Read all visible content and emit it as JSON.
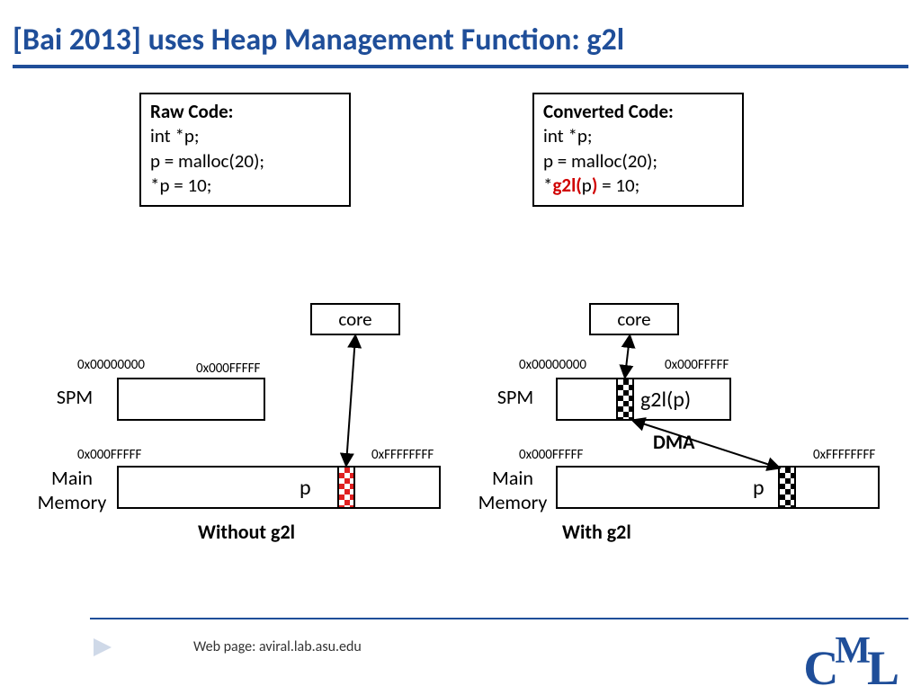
{
  "title": "[Bai 2013] uses Heap Management Function: g2l",
  "rawCode": {
    "header": "Raw Code:",
    "line1": "int *p;",
    "line2": "p = malloc(20);",
    "line3": "*p = 10;"
  },
  "convCode": {
    "header": "Converted Code:",
    "line1": "int *p;",
    "line2": "p = malloc(20);",
    "line3prefix": "*",
    "line3g2lOpen": "g2l(",
    "line3arg": "p",
    "line3g2lClose": ")",
    "line3suffix": " = 10;"
  },
  "labels": {
    "core": "core",
    "spm": "SPM",
    "mainMemory1": "Main",
    "mainMemory2": "Memory",
    "p": "p",
    "g2lp": "g2l(p)",
    "dma": "DMA",
    "withoutCaption": "Without g2l",
    "withCaption": "With g2l"
  },
  "addresses": {
    "zero": "0x00000000",
    "low": "0x000FFFFF",
    "high": "0xFFFFFFFF"
  },
  "footer": {
    "webpage": "Web page:  aviral.lab.asu.edu"
  },
  "logo": {
    "c": "C",
    "m": "M",
    "l": "L"
  }
}
